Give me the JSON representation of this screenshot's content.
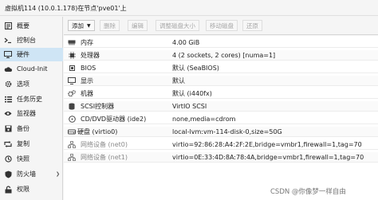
{
  "window": {
    "title": "虚拟机114 (10.0.1.178)在节点'pve01'上"
  },
  "sidebar": {
    "items": [
      {
        "label": "概要",
        "icon": "summary-icon"
      },
      {
        "label": "控制台",
        "icon": "console-icon"
      },
      {
        "label": "硬件",
        "icon": "monitor-icon",
        "active": true
      },
      {
        "label": "Cloud-Init",
        "icon": "cloud-icon"
      },
      {
        "label": "选项",
        "icon": "gear-icon"
      },
      {
        "label": "任务历史",
        "icon": "list-icon"
      },
      {
        "label": "监视器",
        "icon": "eye-icon"
      },
      {
        "label": "备份",
        "icon": "floppy-icon"
      },
      {
        "label": "复制",
        "icon": "retweet-icon"
      },
      {
        "label": "快照",
        "icon": "history-icon"
      },
      {
        "label": "防火墙",
        "icon": "shield-icon"
      },
      {
        "label": "权限",
        "icon": "unlock-icon"
      }
    ]
  },
  "toolbar": {
    "add": "添加",
    "remove": "删除",
    "edit": "编辑",
    "resize_disk": "调整磁盘大小",
    "move_disk": "移动磁盘",
    "revert": "还原"
  },
  "hardware": {
    "rows": [
      {
        "key": "内存",
        "value": "4.00 GiB",
        "icon": "memory-icon"
      },
      {
        "key": "处理器",
        "value": "4 (2 sockets, 2 cores) [numa=1]",
        "icon": "cpu-icon"
      },
      {
        "key": "BIOS",
        "value": "默认 (SeaBIOS)",
        "icon": "bios-icon"
      },
      {
        "key": "显示",
        "value": "默认",
        "icon": "display-icon"
      },
      {
        "key": "机器",
        "value": "默认 (i440fx)",
        "icon": "cogs-icon"
      },
      {
        "key": "SCSI控制器",
        "value": "VirtIO SCSI",
        "icon": "database-icon"
      },
      {
        "key": "CD/DVD驱动器 (ide2)",
        "value": "none,media=cdrom",
        "icon": "cdrom-icon"
      },
      {
        "key": "硬盘 (virtio0)",
        "value": "local-lvm:vm-114-disk-0,size=50G",
        "icon": "hdd-icon"
      },
      {
        "key": "网络设备 (net0)",
        "value": "virtio=92:86:28:A4:2F:2E,bridge=vmbr1,firewall=1,tag=70",
        "icon": "network-icon"
      },
      {
        "key": "网络设备 (net1)",
        "value": "virtio=0E:33:4D:8A:78:4A,bridge=vmbr1,firewall=1,tag=70",
        "icon": "network-icon"
      }
    ]
  },
  "watermark": "CSDN @你像梦一样自由"
}
